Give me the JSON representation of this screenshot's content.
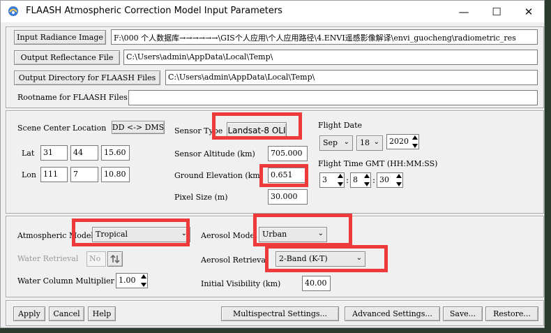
{
  "window": {
    "title": "FLAASH Atmospheric Correction Model Input Parameters",
    "minimize": "—",
    "maximize": "☐",
    "close": "✕"
  },
  "files": {
    "input_radiance_label": "Input Radiance Image",
    "input_radiance_value": "F:\\000 个人数据库→→→→→→\\GIS个人应用\\个人应用路径\\4.ENVI遥感影像解译\\envi_guocheng\\radiometric_res",
    "output_reflectance_label": "Output Reflectance File",
    "output_reflectance_value": "C:\\Users\\admin\\AppData\\Local\\Temp\\",
    "output_directory_label": "Output Directory for FLAASH Files",
    "output_directory_value": "C:\\Users\\admin\\AppData\\Local\\Temp\\",
    "rootname_label": "Rootname for FLAASH Files",
    "rootname_value": ""
  },
  "scene": {
    "center_label": "Scene Center Location",
    "dd_dms_button": "DD <-> DMS",
    "lat_label": "Lat",
    "lat_deg": "31",
    "lat_min": "44",
    "lat_sec": "15.60",
    "lon_label": "Lon",
    "lon_deg": "111",
    "lon_min": "7",
    "lon_sec": "10.80"
  },
  "sensor": {
    "type_label": "Sensor Type",
    "type_value": "Landsat-8 OLI",
    "altitude_label": "Sensor Altitude (km)",
    "altitude_value": "705.000",
    "ground_label": "Ground Elevation (km)",
    "ground_value": "0.651",
    "pixel_label": "Pixel Size (m)",
    "pixel_value": "30.000"
  },
  "flight": {
    "date_label": "Flight Date",
    "month": "Sep",
    "day": "18",
    "year": "2020",
    "time_label": "Flight Time GMT (HH:MM:SS)",
    "hh": "3",
    "mm": "8",
    "ss": "30"
  },
  "atmosphere": {
    "model_label": "Atmospheric Model",
    "model_value": "Tropical",
    "water_retrieval_label": "Water Retrieval",
    "water_retrieval_value": "No",
    "water_column_label": "Water Column Multiplier",
    "water_column_value": "1.00",
    "aerosol_model_label": "Aerosol Model",
    "aerosol_model_value": "Urban",
    "aerosol_retrieval_label": "Aerosol Retrieval",
    "aerosol_retrieval_value": "2-Band (K-T)",
    "visibility_label": "Initial Visibility (km)",
    "visibility_value": "40.00"
  },
  "actions": {
    "apply": "Apply",
    "cancel": "Cancel",
    "help": "Help",
    "multispectral": "Multispectral Settings...",
    "advanced": "Advanced Settings...",
    "save": "Save...",
    "restore": "Restore..."
  },
  "colors": {
    "highlight": "#ee3a3a"
  }
}
